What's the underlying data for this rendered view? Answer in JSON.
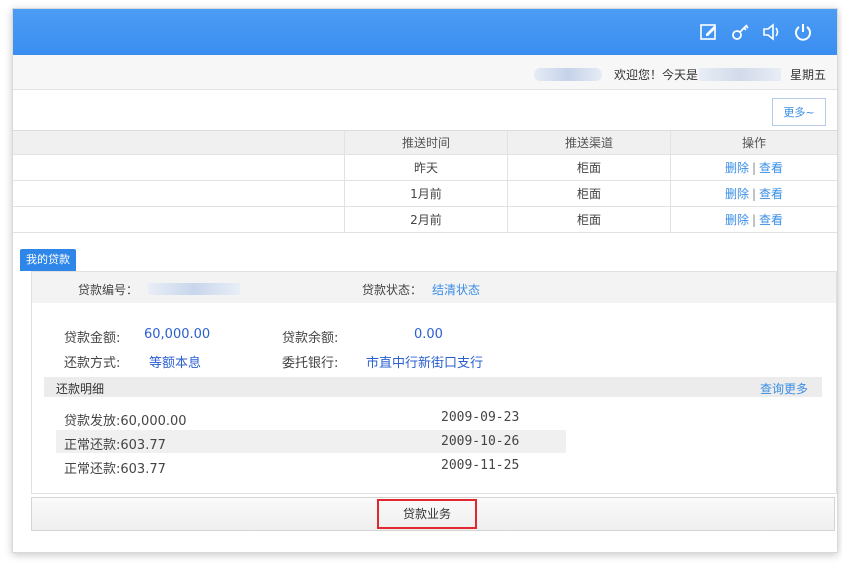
{
  "header": {
    "icons": [
      "edit-icon",
      "key-icon",
      "speaker-icon",
      "power-icon"
    ],
    "accent_color": "#3a8ef0"
  },
  "welcome": {
    "greeting": "欢迎您！今天是",
    "weekday": "星期五"
  },
  "more_button": "更多~",
  "push_table": {
    "columns": [
      "推送时间",
      "推送渠道",
      "操作"
    ],
    "rows": [
      {
        "time": "昨天",
        "channel": "柜面",
        "delete": "删除",
        "view": "查看"
      },
      {
        "time": "1月前",
        "channel": "柜面",
        "delete": "删除",
        "view": "查看"
      },
      {
        "time": "2月前",
        "channel": "柜面",
        "delete": "删除",
        "view": "查看"
      }
    ],
    "separator": "|"
  },
  "loan": {
    "tab_label": "我的贷款",
    "number_label": "贷款编号：",
    "status_label": "贷款状态：",
    "status_value": "结清状态",
    "amount_label": "贷款金额:",
    "amount_value": "60,000.00",
    "balance_label": "贷款余额:",
    "balance_value": "0.00",
    "method_label": "还款方式:",
    "method_value": "等额本息",
    "bank_label": "委托银行:",
    "bank_value": "市直中行新街口支行"
  },
  "repayment": {
    "title": "还款明细",
    "more_link": "查询更多",
    "rows": [
      {
        "item": "贷款发放:60,000.00",
        "date": "2009-09-23"
      },
      {
        "item": "正常还款:603.77",
        "date": "2009-10-26"
      },
      {
        "item": "正常还款:603.77",
        "date": "2009-11-25"
      }
    ]
  },
  "business_button": "贷款业务"
}
